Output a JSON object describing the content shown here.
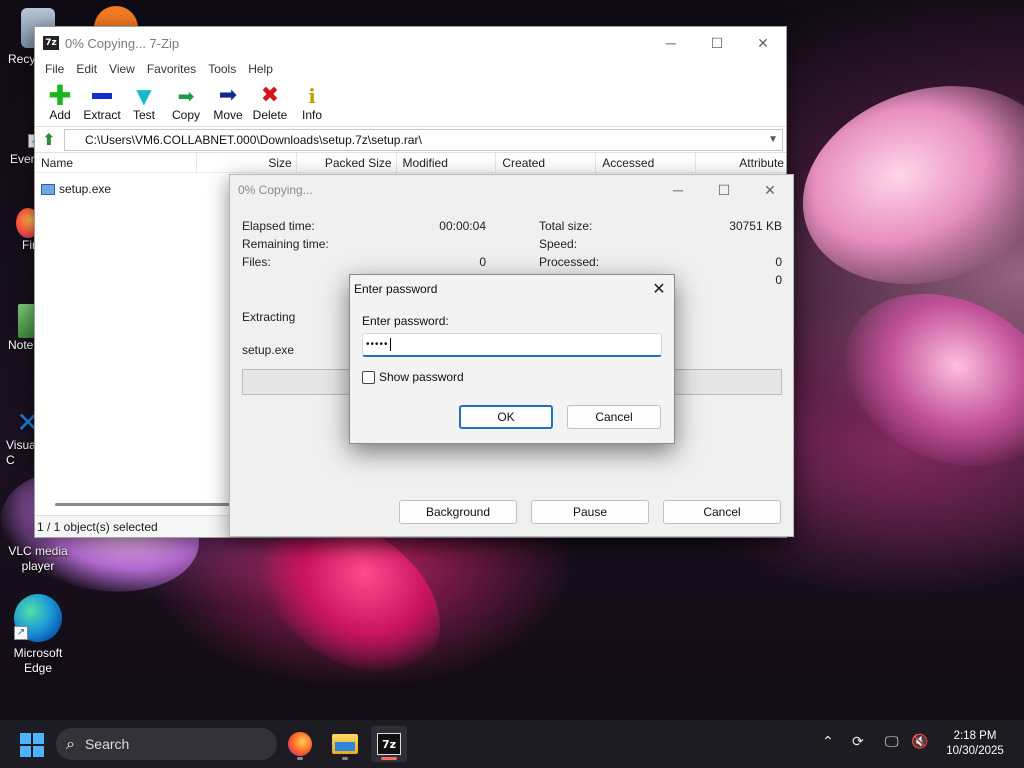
{
  "desktop": {
    "icons": [
      {
        "label": "Recy"
      },
      {
        "label": "Ever"
      },
      {
        "label": "Fir"
      },
      {
        "label": "Note"
      },
      {
        "label": "Visua C"
      },
      {
        "label": "VLC media player"
      },
      {
        "label": "Microsoft Edge"
      }
    ]
  },
  "main_window": {
    "title": "0% Copying... 7-Zip",
    "app_icon": "7z",
    "menu": [
      "File",
      "Edit",
      "View",
      "Favorites",
      "Tools",
      "Help"
    ],
    "toolbar": [
      {
        "label": "Add",
        "icon": "plus-icon",
        "color": "#1db51d"
      },
      {
        "label": "Extract",
        "icon": "minus-icon",
        "color": "#1b2fd1"
      },
      {
        "label": "Test",
        "icon": "check-icon",
        "color": "#19b9c9"
      },
      {
        "label": "Copy",
        "icon": "double-arrow-icon",
        "color": "#1a9b4a"
      },
      {
        "label": "Move",
        "icon": "arrow-right-icon",
        "color": "#0d2a8c"
      },
      {
        "label": "Delete",
        "icon": "x-icon",
        "color": "#d8121a"
      },
      {
        "label": "Info",
        "icon": "info-icon",
        "color": "#b8a400"
      }
    ],
    "address": "C:\\Users\\VM6.COLLABNET.000\\Downloads\\setup.7z\\setup.rar\\",
    "columns": [
      "Name",
      "Size",
      "Packed Size",
      "Modified",
      "Created",
      "Accessed",
      "Attribute"
    ],
    "files": [
      {
        "name": "setup.exe"
      }
    ],
    "status": "1 / 1 object(s) selected"
  },
  "copy_dialog": {
    "title": "0% Copying...",
    "elapsed_label": "Elapsed time:",
    "elapsed_value": "00:00:04",
    "remaining_label": "Remaining time:",
    "files_label": "Files:",
    "files_value": "0",
    "total_size_label": "Total size:",
    "total_size_value": "30751 KB",
    "speed_label": "Speed:",
    "processed_label": "Processed:",
    "processed_value": "0",
    "extra_value": "0",
    "operation": "Extracting",
    "current_file": "setup.exe",
    "progress": 0,
    "buttons": {
      "background": "Background",
      "pause": "Pause",
      "cancel": "Cancel"
    }
  },
  "password_dialog": {
    "title": "Enter password",
    "label": "Enter password:",
    "value_masked": "•••••",
    "show_password_label": "Show password",
    "show_password_checked": false,
    "ok_label": "OK",
    "cancel_label": "Cancel"
  },
  "taskbar": {
    "search_label": "Search",
    "apps": [
      "firefox",
      "file-explorer",
      "7-zip"
    ],
    "active_app": "7-zip",
    "app_7z_label": "7z",
    "time": "2:18 PM",
    "date": "10/30/2025"
  }
}
